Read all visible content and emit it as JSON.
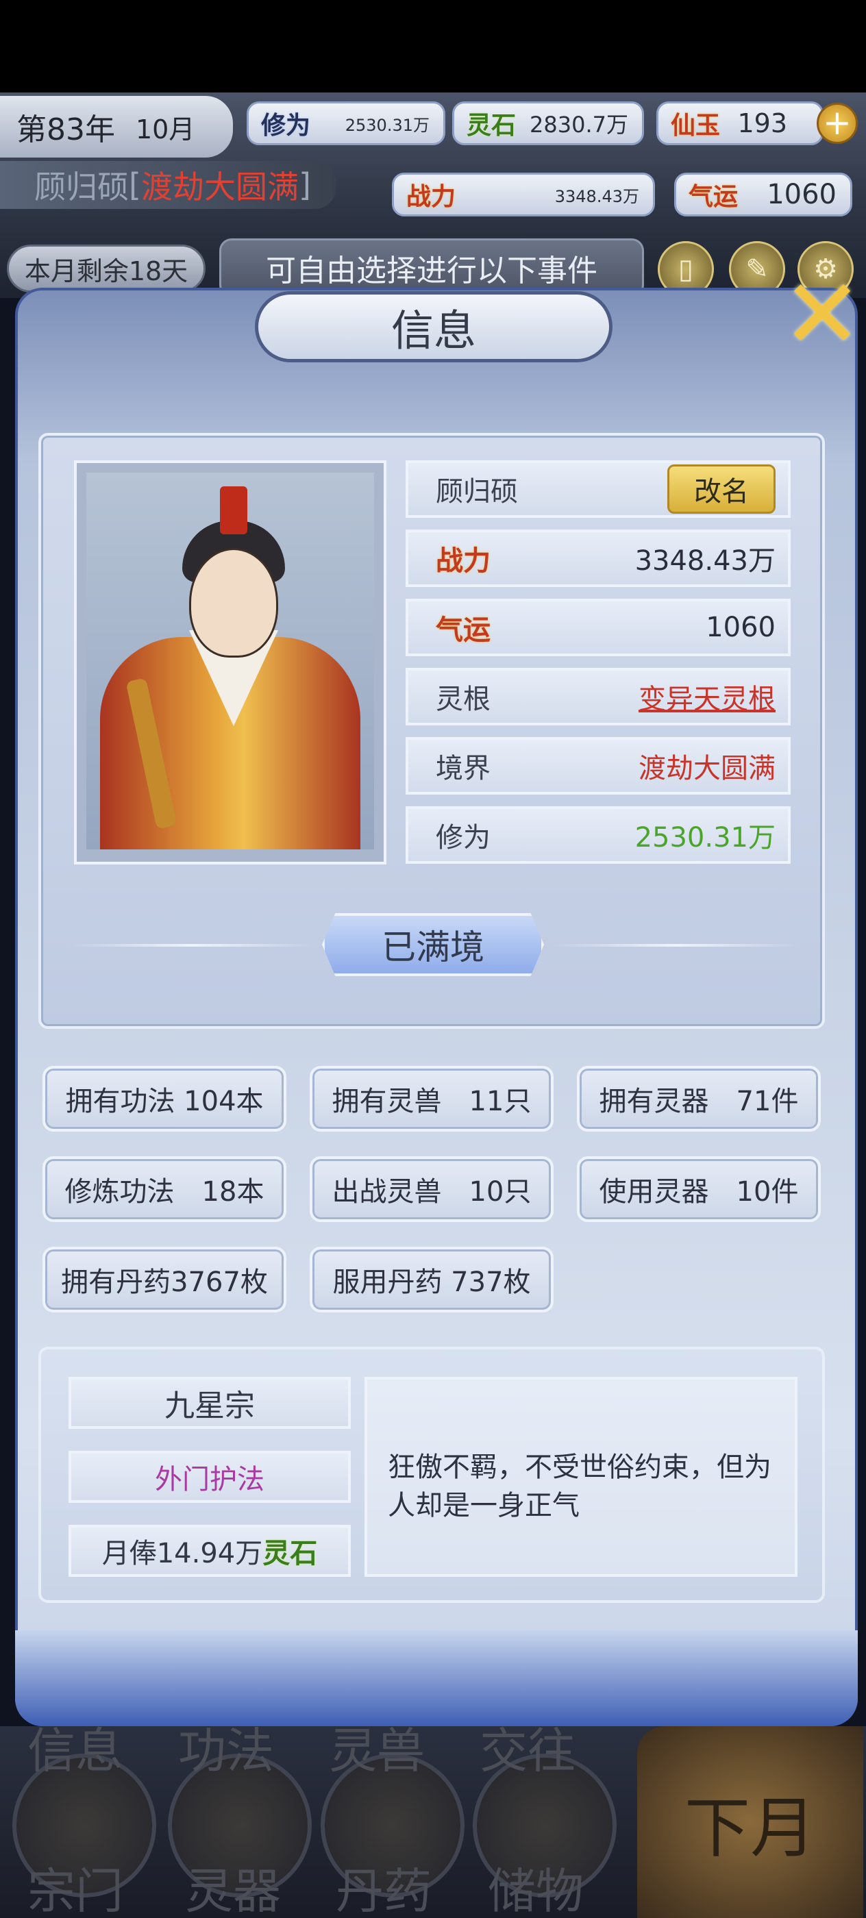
{
  "hud": {
    "year": "第83年",
    "month": "10月",
    "cultivation_icon": "修为",
    "cultivation": "2530.31万",
    "spirit_stone_icon": "灵石",
    "spirit_stone": "2830.7万",
    "jade_icon": "仙玉",
    "jade": "193",
    "name": "顾归硕",
    "realm": "渡劫大圆满",
    "power_icon": "战力",
    "power": "3348.43万",
    "luck_icon": "气运",
    "luck": "1060",
    "month_left": "本月剩余18天",
    "event_text": "可自由选择进行以下事件"
  },
  "panel": {
    "title": "信息",
    "name": "顾归硕",
    "rename": "改名",
    "rows": [
      {
        "label": "战力",
        "value": "3348.43万"
      },
      {
        "label": "气运",
        "value": "1060"
      },
      {
        "label": "灵根",
        "value": "变异天灵根"
      },
      {
        "label": "境界",
        "value": "渡劫大圆满"
      },
      {
        "label": "修为",
        "value": "2530.31万"
      }
    ],
    "full_realm": "已满境",
    "stats": [
      "拥有功法 104本",
      "拥有灵兽　11只",
      "拥有灵器　71件",
      "修炼功法　18本",
      "出战灵兽　10只",
      "使用灵器　10件",
      "拥有丹药3767枚",
      "服用丹药 737枚"
    ],
    "sect": "九星宗",
    "position": "外门护法",
    "salary": "月俸14.94万",
    "salary_unit": "灵石",
    "description": "狂傲不羁，不受世俗约束，但为人却是一身正气"
  },
  "nav": {
    "top_labels": [
      "信息",
      "功法",
      "灵兽",
      "交往"
    ],
    "bottom_labels": [
      "宗门",
      "灵器",
      "丹药",
      "储物"
    ],
    "next_month": "下月"
  },
  "colors": {
    "accent_red": "#c33a20",
    "root_red": "#c8342a",
    "cultivation_green": "#4aa52a",
    "position_purple": "#a93aa2",
    "rename_gold": "#e6c04e"
  }
}
